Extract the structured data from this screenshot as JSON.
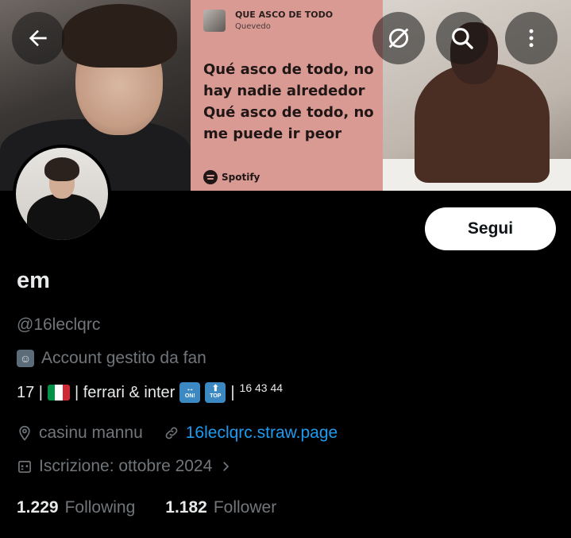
{
  "banner": {
    "lyric_card": {
      "song_title": "QUE ASCO DE TODO",
      "artist": "Quevedo",
      "lyrics": "Qué asco de todo, no hay nadie alrededor Qué asco de todo, no me puede ir peor",
      "brand": "Spotify",
      "background_color": "#d99a94"
    }
  },
  "top_bar": {
    "back_icon": "arrow-left-icon",
    "notifications_icon": "bell-off-icon",
    "search_icon": "search-icon",
    "more_icon": "more-vertical-icon"
  },
  "profile": {
    "follow_label": "Segui",
    "display_name": "em",
    "handle": "@16leclqrc",
    "fan_label": "Account gestito da fan",
    "bio": {
      "part1": "17 |",
      "part2": "| ferrari & inter",
      "part3": "|",
      "small": "16 43 44"
    },
    "location": "casinu mannu",
    "website": "16leclqrc.straw.page",
    "joined": "Iscrizione: ottobre 2024",
    "following_count": "1.229",
    "following_label": "Following",
    "followers_count": "1.182",
    "followers_label": "Follower"
  },
  "colors": {
    "background": "#000000",
    "primary_text": "#e7e9ea",
    "secondary_text": "#71767b",
    "link": "#1d9bf0"
  }
}
